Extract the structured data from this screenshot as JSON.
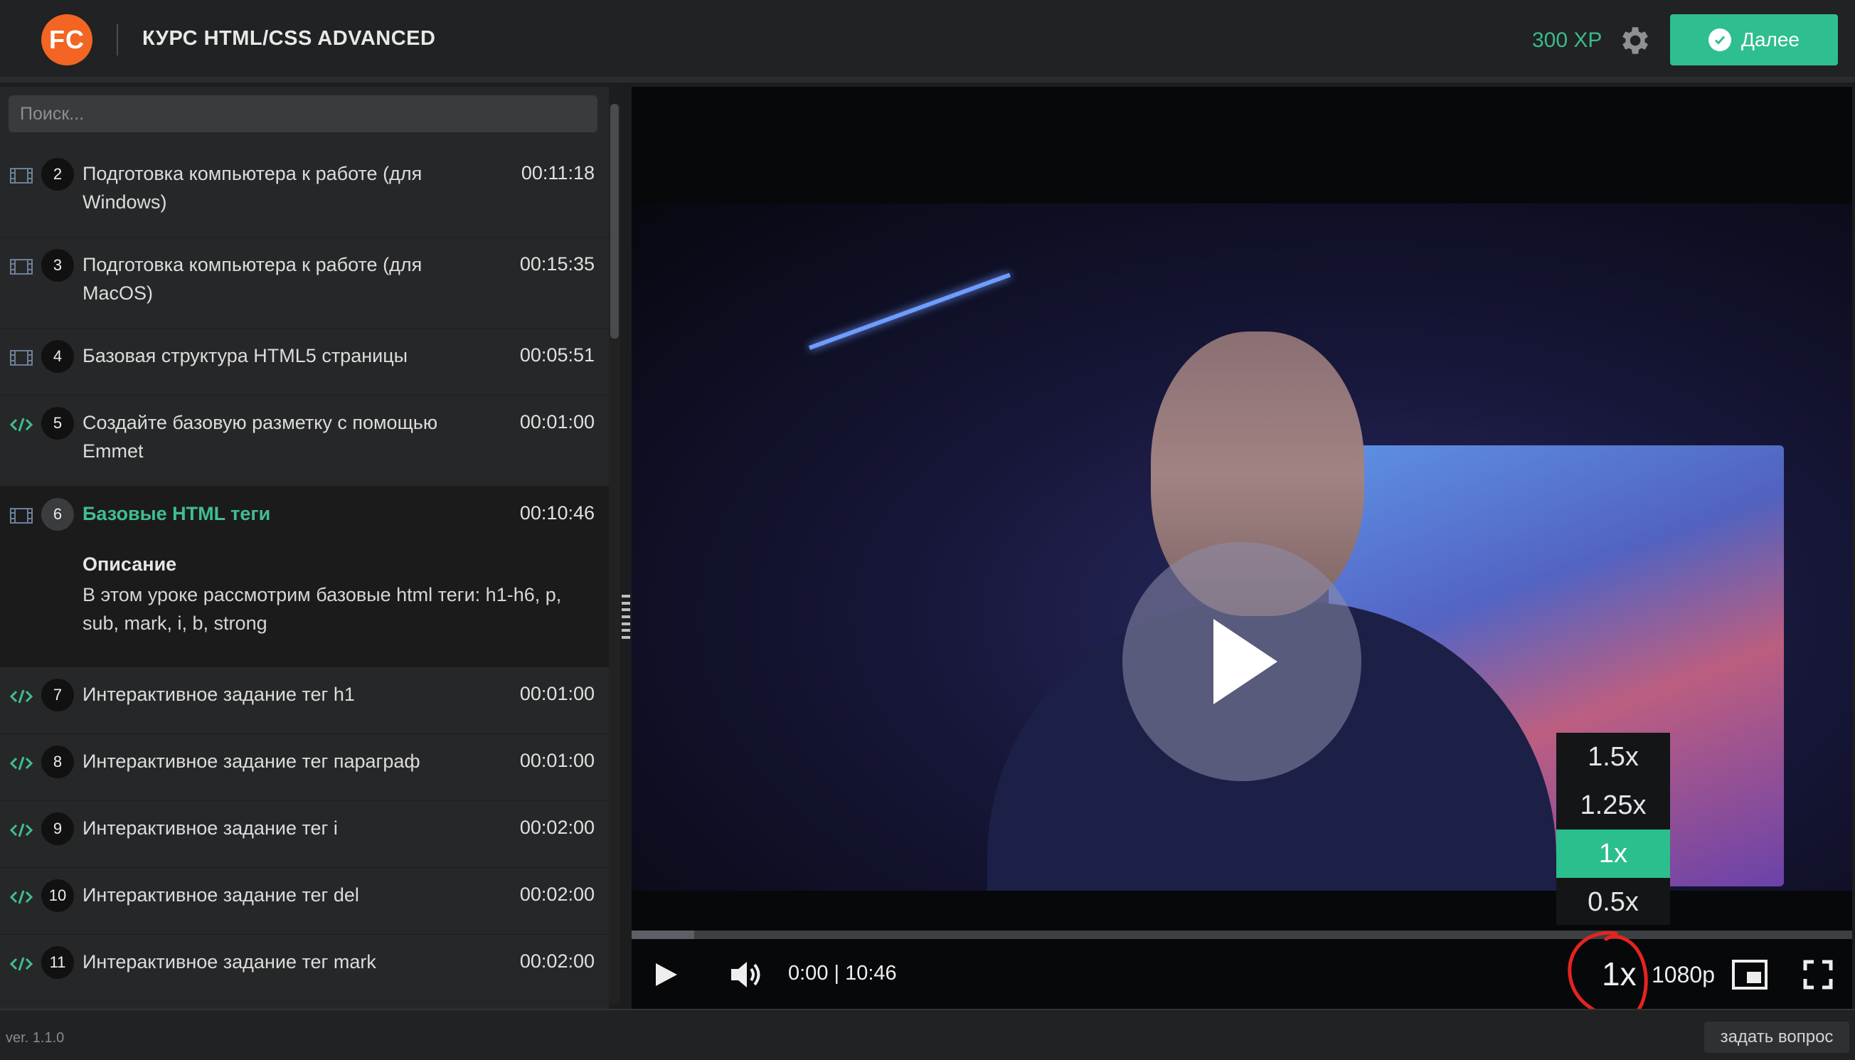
{
  "header": {
    "logo_text": "FC",
    "course_title": "КУРС HTML/CSS ADVANCED",
    "xp": "300 XP",
    "next_label": "Далее",
    "accent_color": "#2fbe8f",
    "logo_color": "#f26522"
  },
  "sidebar": {
    "search_placeholder": "Поиск...",
    "lessons": [
      {
        "num": "2",
        "type": "video",
        "title": "Подготовка компьютера к работе (для Windows)",
        "duration": "00:11:18"
      },
      {
        "num": "3",
        "type": "video",
        "title": "Подготовка компьютера к работе (для MacOS)",
        "duration": "00:15:35"
      },
      {
        "num": "4",
        "type": "video",
        "title": "Базовая структура HTML5 страницы",
        "duration": "00:05:51"
      },
      {
        "num": "5",
        "type": "code",
        "title": "Создайте базовую разметку с помощью Emmet",
        "duration": "00:01:00"
      },
      {
        "num": "6",
        "type": "video",
        "title": "Базовые HTML теги",
        "duration": "00:10:46",
        "active": true,
        "description_heading": "Описание",
        "description": "В этом уроке рассмотрим базовые html теги: h1-h6, p, sub, mark, i, b, strong"
      },
      {
        "num": "7",
        "type": "code",
        "title": "Интерактивное задание тег h1",
        "duration": "00:01:00"
      },
      {
        "num": "8",
        "type": "code",
        "title": "Интерактивное задание тег параграф",
        "duration": "00:01:00"
      },
      {
        "num": "9",
        "type": "code",
        "title": "Интерактивное задание тег i",
        "duration": "00:02:00"
      },
      {
        "num": "10",
        "type": "code",
        "title": "Интерактивное задание тег del",
        "duration": "00:02:00"
      },
      {
        "num": "11",
        "type": "code",
        "title": "Интерактивное задание тег mark",
        "duration": "00:02:00"
      }
    ]
  },
  "player": {
    "time_display": "0:00 | 10:46",
    "speed_label": "1x",
    "quality_label": "1080p",
    "speed_options": [
      "1.5x",
      "1.25x",
      "1x",
      "0.5x"
    ],
    "selected_speed": "1x",
    "progress_fraction": 0
  },
  "footer": {
    "version": "ver. 1.1.0",
    "ask_label": "задать вопрос"
  }
}
